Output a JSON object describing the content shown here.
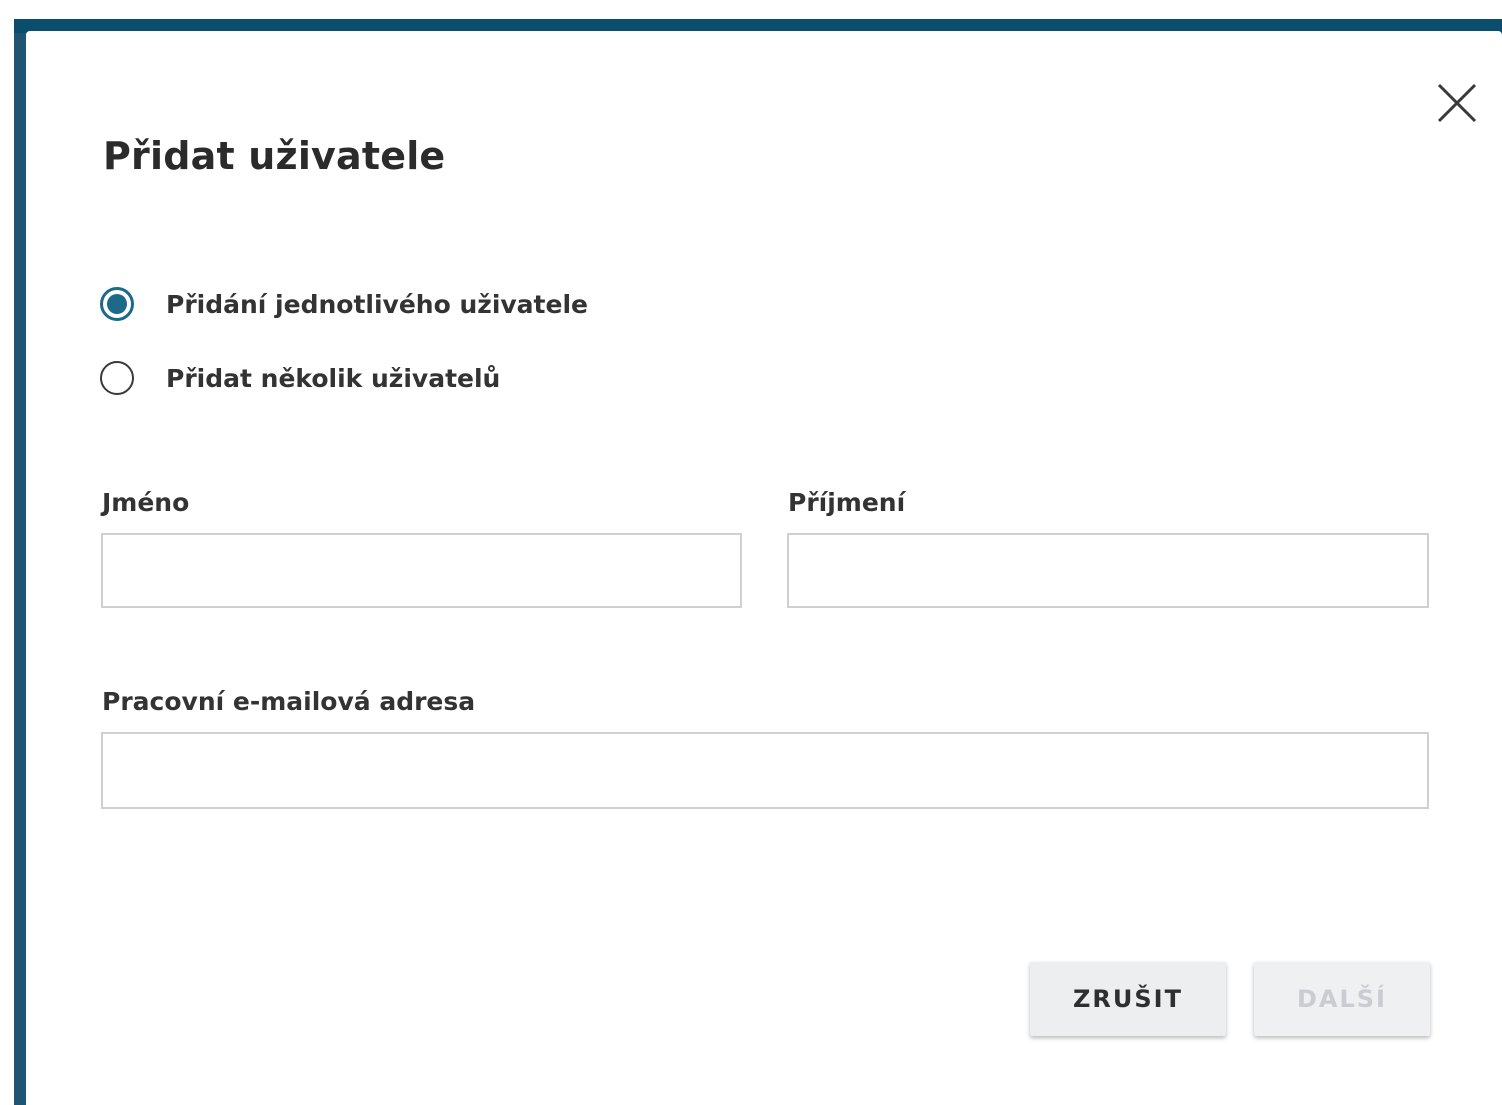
{
  "dialog": {
    "title": "Přidat uživatele",
    "close_icon": "close-icon",
    "mode_options": [
      {
        "label": "Přidání jednotlivého uživatele",
        "selected": true
      },
      {
        "label": "Přidat několik uživatelů",
        "selected": false
      }
    ],
    "fields": {
      "first_name": {
        "label": "Jméno",
        "value": "",
        "placeholder": ""
      },
      "last_name": {
        "label": "Příjmení",
        "value": "",
        "placeholder": ""
      },
      "email": {
        "label": "Pracovní e-mailová adresa",
        "value": "",
        "placeholder": ""
      }
    },
    "buttons": {
      "cancel": "ZRUŠIT",
      "next": "DALŠÍ",
      "next_disabled": true
    }
  },
  "colors": {
    "backdrop": "#1d5572",
    "accent": "#1b6a8a",
    "text": "#333333",
    "input_border": "#d0d0d0",
    "button_bg": "#eceef0"
  }
}
